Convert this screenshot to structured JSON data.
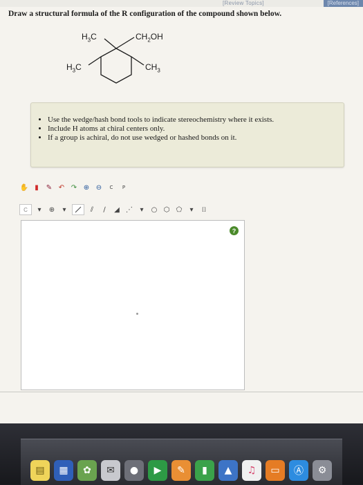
{
  "header": {
    "review_link": "[Review Topics]",
    "references_tab": "[References]"
  },
  "question": {
    "prompt": "Draw a structural formula of the R configuration of the compound shown below."
  },
  "molecule": {
    "label_top_left": {
      "main": "H",
      "sub": "3",
      "tail": "C"
    },
    "label_top_right": {
      "main": "CH",
      "sub": "2",
      "tail": "OH"
    },
    "label_left": {
      "main": "H",
      "sub": "3",
      "tail": "C"
    },
    "label_right": {
      "main": "CH",
      "sub": "3",
      "tail": ""
    }
  },
  "instructions": {
    "items": [
      "Use the wedge/hash bond tools to indicate stereochemistry where it exists.",
      "Include H atoms at chiral centers only.",
      "If a group is achiral, do not use wedged or hashed bonds on it."
    ]
  },
  "toolbar": {
    "row1": [
      "hand-icon",
      "eraser-icon",
      "pencil-icon",
      "undo-icon",
      "redo-icon",
      "zoom-in-icon",
      "zoom-out-icon",
      "clean-icon",
      "template-icon"
    ],
    "carbon_label": "C",
    "charge_label": "⊕",
    "bracket_label": "[]"
  },
  "canvas": {
    "help_label": "?"
  }
}
